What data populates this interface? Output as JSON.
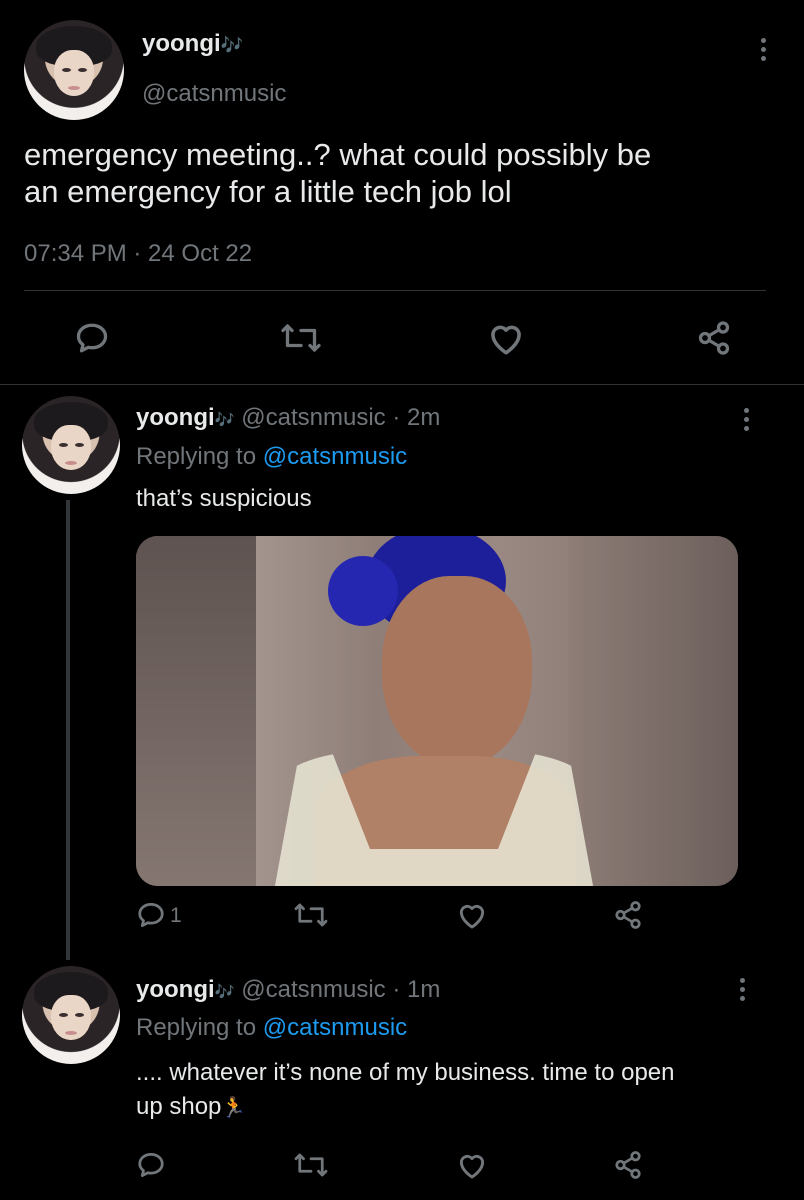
{
  "main_tweet": {
    "display_name": "yoongi",
    "emoji": "🎶",
    "handle": "@catsnmusic",
    "text_line1": "emergency meeting..? what could possibly be",
    "text_line2": "an emergency for a little tech job lol",
    "timestamp": "07:34 PM · 24 Oct 22"
  },
  "reply1": {
    "display_name": "yoongi",
    "emoji": "🎶",
    "handle": "@catsnmusic",
    "time": "· 2m",
    "replying_prefix": "Replying to",
    "replying_handle": "@catsnmusic",
    "text": "that’s suspicious",
    "reply_count": "1"
  },
  "reply2": {
    "display_name": "yoongi",
    "emoji": "🎶",
    "handle": "@catsnmusic",
    "time": "· 1m",
    "replying_prefix": "Replying to",
    "replying_handle": "@catsnmusic",
    "text_line1": ".... whatever it’s none of my business. time to open",
    "text_line2": "up shop",
    "text_emoji": "🏃"
  },
  "colors": {
    "background": "#000000",
    "text": "#e7e9ea",
    "muted": "#71767b",
    "link": "#1d9bf0",
    "divider": "#2f3336"
  }
}
